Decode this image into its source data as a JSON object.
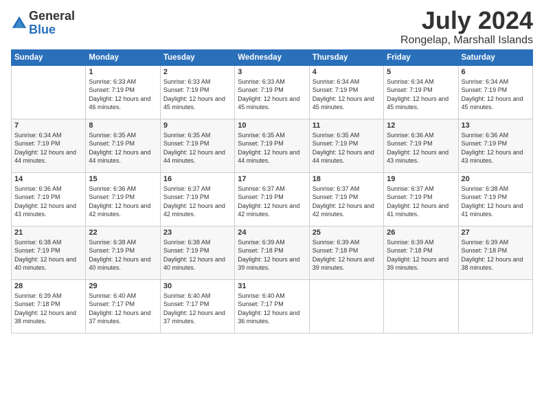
{
  "logo": {
    "general": "General",
    "blue": "Blue"
  },
  "title": "July 2024",
  "subtitle": "Rongelap, Marshall Islands",
  "days_of_week": [
    "Sunday",
    "Monday",
    "Tuesday",
    "Wednesday",
    "Thursday",
    "Friday",
    "Saturday"
  ],
  "weeks": [
    [
      {
        "num": "",
        "sunrise": "",
        "sunset": "",
        "daylight": ""
      },
      {
        "num": "1",
        "sunrise": "Sunrise: 6:33 AM",
        "sunset": "Sunset: 7:19 PM",
        "daylight": "Daylight: 12 hours and 46 minutes."
      },
      {
        "num": "2",
        "sunrise": "Sunrise: 6:33 AM",
        "sunset": "Sunset: 7:19 PM",
        "daylight": "Daylight: 12 hours and 45 minutes."
      },
      {
        "num": "3",
        "sunrise": "Sunrise: 6:33 AM",
        "sunset": "Sunset: 7:19 PM",
        "daylight": "Daylight: 12 hours and 45 minutes."
      },
      {
        "num": "4",
        "sunrise": "Sunrise: 6:34 AM",
        "sunset": "Sunset: 7:19 PM",
        "daylight": "Daylight: 12 hours and 45 minutes."
      },
      {
        "num": "5",
        "sunrise": "Sunrise: 6:34 AM",
        "sunset": "Sunset: 7:19 PM",
        "daylight": "Daylight: 12 hours and 45 minutes."
      },
      {
        "num": "6",
        "sunrise": "Sunrise: 6:34 AM",
        "sunset": "Sunset: 7:19 PM",
        "daylight": "Daylight: 12 hours and 45 minutes."
      }
    ],
    [
      {
        "num": "7",
        "sunrise": "Sunrise: 6:34 AM",
        "sunset": "Sunset: 7:19 PM",
        "daylight": "Daylight: 12 hours and 44 minutes."
      },
      {
        "num": "8",
        "sunrise": "Sunrise: 6:35 AM",
        "sunset": "Sunset: 7:19 PM",
        "daylight": "Daylight: 12 hours and 44 minutes."
      },
      {
        "num": "9",
        "sunrise": "Sunrise: 6:35 AM",
        "sunset": "Sunset: 7:19 PM",
        "daylight": "Daylight: 12 hours and 44 minutes."
      },
      {
        "num": "10",
        "sunrise": "Sunrise: 6:35 AM",
        "sunset": "Sunset: 7:19 PM",
        "daylight": "Daylight: 12 hours and 44 minutes."
      },
      {
        "num": "11",
        "sunrise": "Sunrise: 6:35 AM",
        "sunset": "Sunset: 7:19 PM",
        "daylight": "Daylight: 12 hours and 44 minutes."
      },
      {
        "num": "12",
        "sunrise": "Sunrise: 6:36 AM",
        "sunset": "Sunset: 7:19 PM",
        "daylight": "Daylight: 12 hours and 43 minutes."
      },
      {
        "num": "13",
        "sunrise": "Sunrise: 6:36 AM",
        "sunset": "Sunset: 7:19 PM",
        "daylight": "Daylight: 12 hours and 43 minutes."
      }
    ],
    [
      {
        "num": "14",
        "sunrise": "Sunrise: 6:36 AM",
        "sunset": "Sunset: 7:19 PM",
        "daylight": "Daylight: 12 hours and 43 minutes."
      },
      {
        "num": "15",
        "sunrise": "Sunrise: 6:36 AM",
        "sunset": "Sunset: 7:19 PM",
        "daylight": "Daylight: 12 hours and 42 minutes."
      },
      {
        "num": "16",
        "sunrise": "Sunrise: 6:37 AM",
        "sunset": "Sunset: 7:19 PM",
        "daylight": "Daylight: 12 hours and 42 minutes."
      },
      {
        "num": "17",
        "sunrise": "Sunrise: 6:37 AM",
        "sunset": "Sunset: 7:19 PM",
        "daylight": "Daylight: 12 hours and 42 minutes."
      },
      {
        "num": "18",
        "sunrise": "Sunrise: 6:37 AM",
        "sunset": "Sunset: 7:19 PM",
        "daylight": "Daylight: 12 hours and 42 minutes."
      },
      {
        "num": "19",
        "sunrise": "Sunrise: 6:37 AM",
        "sunset": "Sunset: 7:19 PM",
        "daylight": "Daylight: 12 hours and 41 minutes."
      },
      {
        "num": "20",
        "sunrise": "Sunrise: 6:38 AM",
        "sunset": "Sunset: 7:19 PM",
        "daylight": "Daylight: 12 hours and 41 minutes."
      }
    ],
    [
      {
        "num": "21",
        "sunrise": "Sunrise: 6:38 AM",
        "sunset": "Sunset: 7:19 PM",
        "daylight": "Daylight: 12 hours and 40 minutes."
      },
      {
        "num": "22",
        "sunrise": "Sunrise: 6:38 AM",
        "sunset": "Sunset: 7:19 PM",
        "daylight": "Daylight: 12 hours and 40 minutes."
      },
      {
        "num": "23",
        "sunrise": "Sunrise: 6:38 AM",
        "sunset": "Sunset: 7:19 PM",
        "daylight": "Daylight: 12 hours and 40 minutes."
      },
      {
        "num": "24",
        "sunrise": "Sunrise: 6:39 AM",
        "sunset": "Sunset: 7:18 PM",
        "daylight": "Daylight: 12 hours and 39 minutes."
      },
      {
        "num": "25",
        "sunrise": "Sunrise: 6:39 AM",
        "sunset": "Sunset: 7:18 PM",
        "daylight": "Daylight: 12 hours and 39 minutes."
      },
      {
        "num": "26",
        "sunrise": "Sunrise: 6:39 AM",
        "sunset": "Sunset: 7:18 PM",
        "daylight": "Daylight: 12 hours and 39 minutes."
      },
      {
        "num": "27",
        "sunrise": "Sunrise: 6:39 AM",
        "sunset": "Sunset: 7:18 PM",
        "daylight": "Daylight: 12 hours and 38 minutes."
      }
    ],
    [
      {
        "num": "28",
        "sunrise": "Sunrise: 6:39 AM",
        "sunset": "Sunset: 7:18 PM",
        "daylight": "Daylight: 12 hours and 38 minutes."
      },
      {
        "num": "29",
        "sunrise": "Sunrise: 6:40 AM",
        "sunset": "Sunset: 7:17 PM",
        "daylight": "Daylight: 12 hours and 37 minutes."
      },
      {
        "num": "30",
        "sunrise": "Sunrise: 6:40 AM",
        "sunset": "Sunset: 7:17 PM",
        "daylight": "Daylight: 12 hours and 37 minutes."
      },
      {
        "num": "31",
        "sunrise": "Sunrise: 6:40 AM",
        "sunset": "Sunset: 7:17 PM",
        "daylight": "Daylight: 12 hours and 36 minutes."
      },
      {
        "num": "",
        "sunrise": "",
        "sunset": "",
        "daylight": ""
      },
      {
        "num": "",
        "sunrise": "",
        "sunset": "",
        "daylight": ""
      },
      {
        "num": "",
        "sunrise": "",
        "sunset": "",
        "daylight": ""
      }
    ]
  ]
}
